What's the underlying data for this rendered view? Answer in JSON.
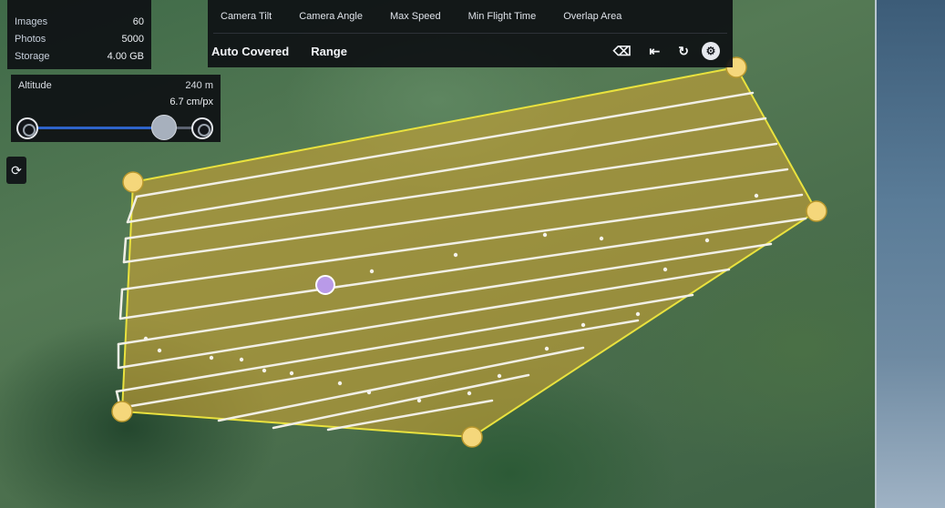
{
  "stats_panel": {
    "rows": [
      {
        "label": "Images",
        "value": "60"
      },
      {
        "label": "Photos",
        "value": "5000"
      },
      {
        "label": "Storage",
        "value": "4.00 GB"
      }
    ]
  },
  "altitude_panel": {
    "label": "Altitude",
    "value": "240 m",
    "sub_value": "6.7 cm/px",
    "slider_level": 0.74
  },
  "toolbar": {
    "tabs": [
      "Camera Tilt",
      "Camera Angle",
      "Max Speed",
      "Min Flight Time",
      "Overlap Area"
    ],
    "actions": [
      "Auto Covered",
      "Range"
    ],
    "tool_icons": [
      "delete-vertex-icon",
      "move-left-icon",
      "rotate-icon",
      "settings-icon"
    ]
  },
  "colors": {
    "polygon_fill": "#c8a234",
    "polygon_stroke": "#e9e23e",
    "vertex": "#f5d77b",
    "flight_lines": "#f1efe6",
    "center_marker": "#b99ae8"
  }
}
